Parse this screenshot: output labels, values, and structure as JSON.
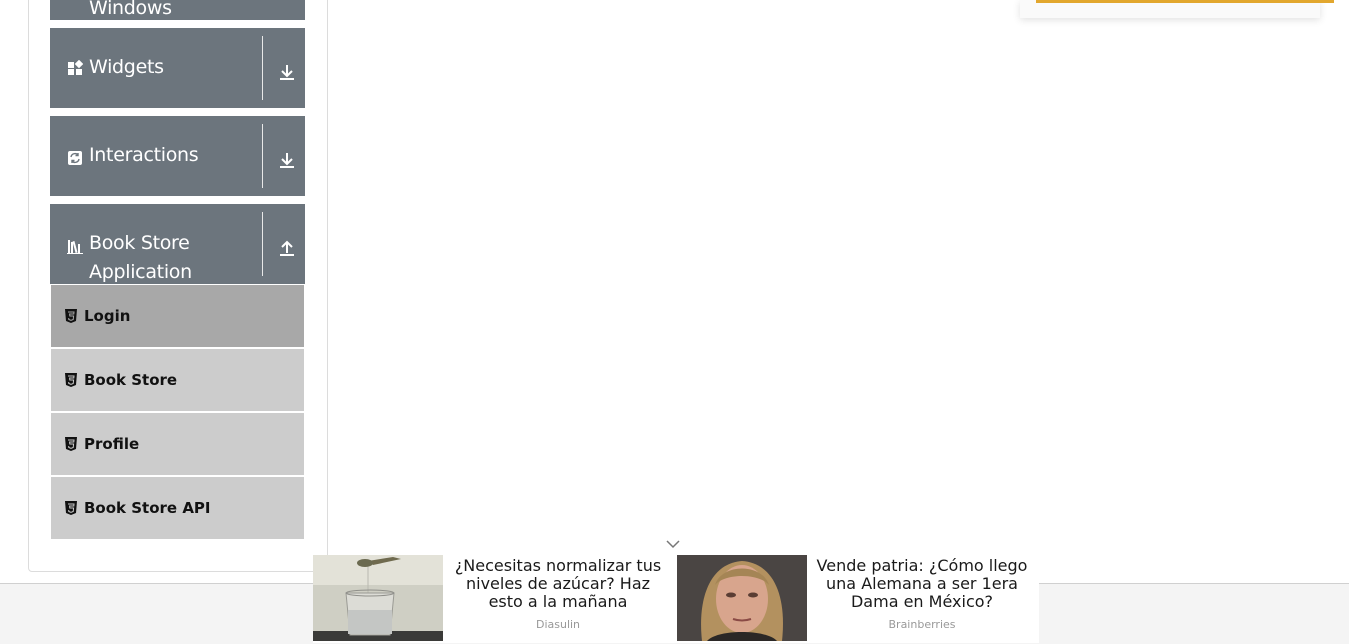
{
  "sidebar": {
    "groups": [
      {
        "label": "Windows",
        "icon": "windows-icon"
      },
      {
        "label": "Widgets",
        "icon": "widgets-icon",
        "toggle": "download-icon"
      },
      {
        "label": "Interactions",
        "icon": "interactions-icon",
        "toggle": "download-icon"
      },
      {
        "label_line1": "Book Store",
        "label_line2": "Application",
        "icon": "books-icon",
        "toggle": "upload-icon"
      }
    ],
    "items": [
      {
        "label": "Login",
        "icon": "html5-icon",
        "active": true
      },
      {
        "label": "Book Store",
        "icon": "html5-icon"
      },
      {
        "label": "Profile",
        "icon": "html5-icon"
      },
      {
        "label": "Book Store API",
        "icon": "html5-icon"
      }
    ]
  },
  "ads": [
    {
      "headline": "¿Necesitas normalizar tus niveles de azúcar? Haz esto a la mañana",
      "source": "Diasulin"
    },
    {
      "headline": "Vende patria: ¿Cómo llego una Alemana a ser 1era Dama en México?",
      "source": "Brainberries"
    }
  ],
  "colors": {
    "group_bg": "#6c757d",
    "item_bg": "#cccccc",
    "item_active_bg": "#a8a8a8",
    "accent": "#e2a72e"
  }
}
